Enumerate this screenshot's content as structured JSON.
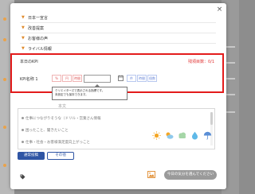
{
  "accordion": [
    "日本一宣言",
    "改善提案",
    "お客様の声",
    "ライバル情報"
  ],
  "kpi": {
    "section_title": "本日のKPI",
    "count": "残項目数：0/1",
    "name_label": "KPI名称 1",
    "units_left": [
      "%",
      "円",
      "時間"
    ],
    "units_right": [
      "件",
      "時間",
      "個数"
    ]
  },
  "tooltip": {
    "line1": "クリエイターズで表示される指標です。",
    "line2": "未設定でも保存できます。"
  },
  "caption": "本文",
  "report": {
    "prompts": [
      "仕事につながりそうな（ドリル・営業さん情報",
      "困ったこと、聞きたいこと",
      "仕事・社会・お客様満足度向上がっこと"
    ]
  },
  "tabs": {
    "normal": "通常投稿",
    "other": "その他"
  },
  "weather_icons": [
    "sunny-icon",
    "partly-cloudy-icon",
    "cloudy-icon",
    "rain-icon",
    "umbrella-icon"
  ],
  "submit_label": "今日の気分を選んでください",
  "colors": {
    "highlight": "#e31b1b",
    "accent": "#e08a2c",
    "primary": "#2f55a4",
    "submit_disabled": "#9a9a9a"
  }
}
